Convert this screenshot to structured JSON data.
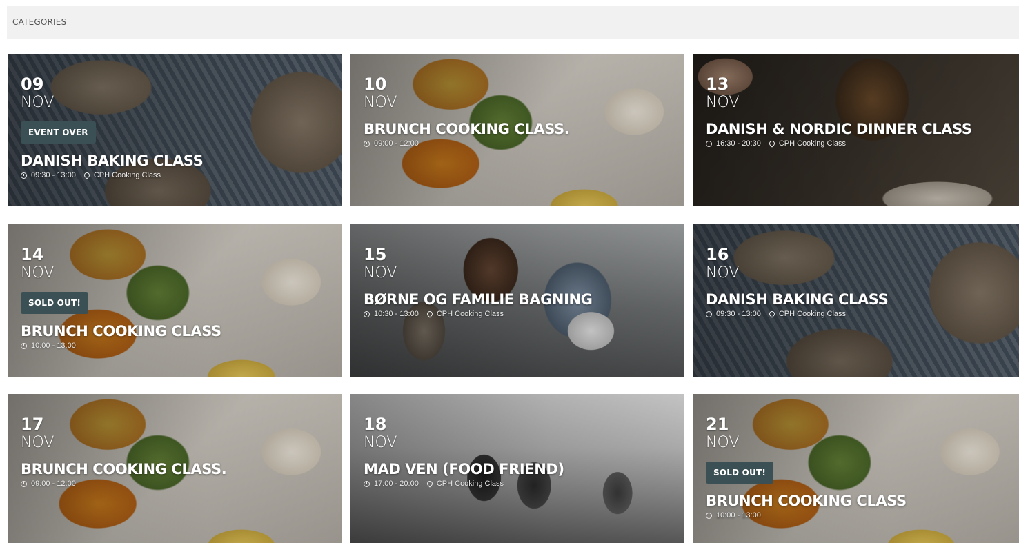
{
  "header": {
    "title": "CATEGORIES"
  },
  "events": [
    {
      "day": "09",
      "month": "NOV",
      "badge": "EVENT OVER",
      "title": "DANISH BAKING CLASS",
      "time": "09:30 - 13:00",
      "location": "CPH Cooking Class",
      "image": "bread"
    },
    {
      "day": "10",
      "month": "NOV",
      "badge": "",
      "title": "BRUNCH COOKING CLASS.",
      "time": "09:00 - 12:00",
      "location": "",
      "image": "brunch"
    },
    {
      "day": "13",
      "month": "NOV",
      "badge": "",
      "title": "DANISH & NORDIC DINNER CLASS",
      "time": "16:30 - 20:30",
      "location": "CPH Cooking Class",
      "image": "dinner"
    },
    {
      "day": "14",
      "month": "NOV",
      "badge": "SOLD OUT!",
      "title": "BRUNCH COOKING CLASS",
      "time": "10:00 - 13:00",
      "location": "",
      "image": "brunch"
    },
    {
      "day": "15",
      "month": "NOV",
      "badge": "",
      "title": "BØRNE OG FAMILIE BAGNING",
      "time": "10:30 - 13:00",
      "location": "CPH Cooking Class",
      "image": "kids"
    },
    {
      "day": "16",
      "month": "NOV",
      "badge": "",
      "title": "DANISH BAKING CLASS",
      "time": "09:30 - 13:00",
      "location": "CPH Cooking Class",
      "image": "bread"
    },
    {
      "day": "17",
      "month": "NOV",
      "badge": "",
      "title": "BRUNCH COOKING CLASS.",
      "time": "09:00 - 12:00",
      "location": "",
      "image": "brunch"
    },
    {
      "day": "18",
      "month": "NOV",
      "badge": "",
      "title": "MAD VEN (FOOD FRIEND)",
      "time": "17:00 - 20:00",
      "location": "CPH Cooking Class",
      "image": "bw"
    },
    {
      "day": "21",
      "month": "NOV",
      "badge": "SOLD OUT!",
      "title": "BRUNCH COOKING CLASS",
      "time": "10:00 - 13:00",
      "location": "",
      "image": "brunch"
    }
  ],
  "colors": {
    "badge_bg": "#3b5054",
    "header_bg": "#f1f1f1"
  }
}
